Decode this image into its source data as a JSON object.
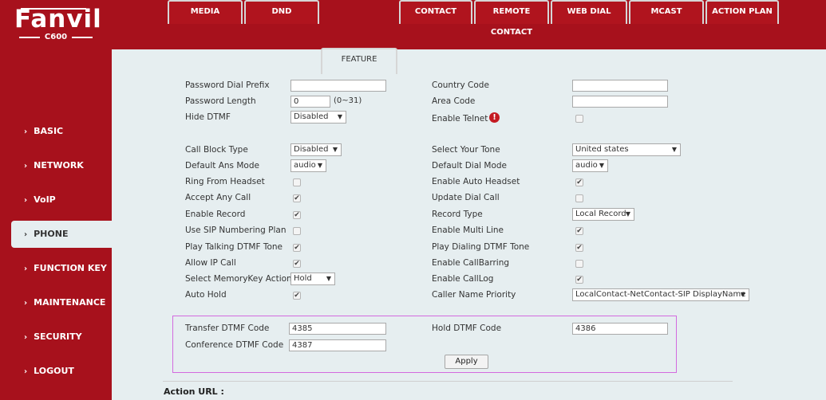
{
  "brand": {
    "name": "Fanvil",
    "model": "C600"
  },
  "sidebar": {
    "items": [
      {
        "label": "BASIC",
        "chevron": "›"
      },
      {
        "label": "NETWORK",
        "chevron": "›"
      },
      {
        "label": "VoIP",
        "chevron": "›"
      },
      {
        "label": "PHONE",
        "chevron": "›"
      },
      {
        "label": "FUNCTION KEY",
        "chevron": "›"
      },
      {
        "label": "MAINTENANCE",
        "chevron": "›"
      },
      {
        "label": "SECURITY",
        "chevron": "›"
      },
      {
        "label": "LOGOUT",
        "chevron": "›"
      }
    ],
    "active": "PHONE"
  },
  "tabs": [
    "MEDIA",
    "DND",
    "FEATURE",
    "CONTACT",
    "REMOTE CONTACT",
    "WEB DIAL",
    "MCAST",
    "ACTION PLAN"
  ],
  "active_tab": "FEATURE",
  "left": {
    "password_dial_prefix": {
      "label": "Password Dial Prefix",
      "value": ""
    },
    "password_length": {
      "label": "Password Length",
      "value": "0",
      "hint": "(0~31)"
    },
    "hide_dtmf": {
      "label": "Hide DTMF",
      "value": "Disabled"
    },
    "call_block_type": {
      "label": "Call Block Type",
      "value": "Disabled"
    },
    "default_ans_mode": {
      "label": "Default Ans Mode",
      "value": "audio"
    },
    "ring_from_headset": {
      "label": "Ring From Headset",
      "checked": false
    },
    "accept_any_call": {
      "label": "Accept Any Call",
      "checked": true
    },
    "enable_record": {
      "label": "Enable Record",
      "checked": true
    },
    "use_sip_numbering_plan": {
      "label": "Use SIP Numbering Plan",
      "checked": false
    },
    "play_talking_dtmf_tone": {
      "label": "Play Talking DTMF Tone",
      "checked": true
    },
    "allow_ip_call": {
      "label": "Allow IP Call",
      "checked": true
    },
    "select_memorykey_action": {
      "label": "Select MemoryKey Action",
      "value": "Hold"
    },
    "auto_hold": {
      "label": "Auto Hold",
      "checked": true
    }
  },
  "right": {
    "country_code": {
      "label": "Country Code",
      "value": ""
    },
    "area_code": {
      "label": "Area Code",
      "value": ""
    },
    "enable_telnet": {
      "label": "Enable Telnet",
      "checked": false
    },
    "select_your_tone": {
      "label": "Select Your Tone",
      "value": "United states"
    },
    "default_dial_mode": {
      "label": "Default Dial Mode",
      "value": "audio"
    },
    "enable_auto_headset": {
      "label": "Enable Auto Headset",
      "checked": true
    },
    "update_dial_call": {
      "label": "Update Dial Call",
      "checked": false
    },
    "record_type": {
      "label": "Record Type",
      "value": "Local Record"
    },
    "enable_multi_line": {
      "label": "Enable Multi Line",
      "checked": true
    },
    "play_dialing_dtmf_tone": {
      "label": "Play Dialing DTMF Tone",
      "checked": true
    },
    "enable_callbarring": {
      "label": "Enable CallBarring",
      "checked": false
    },
    "enable_calllog": {
      "label": "Enable CallLog",
      "checked": true
    },
    "caller_name_priority": {
      "label": "Caller Name Priority",
      "value": "LocalContact-NetContact-SIP DisplayName"
    }
  },
  "dtmf": {
    "transfer": {
      "label": "Transfer DTMF Code",
      "value": "4385"
    },
    "hold": {
      "label": "Hold DTMF Code",
      "value": "4386"
    },
    "conference": {
      "label": "Conference DTMF Code",
      "value": "4387"
    },
    "apply_label": "Apply"
  },
  "action_url_title": "Action URL :",
  "icons": {
    "warning": "!",
    "dropdown": "▼",
    "check": "✔"
  },
  "colors": {
    "brand_red": "#a7111c",
    "content_bg": "#e6eef0",
    "box_border": "#d36adf"
  }
}
